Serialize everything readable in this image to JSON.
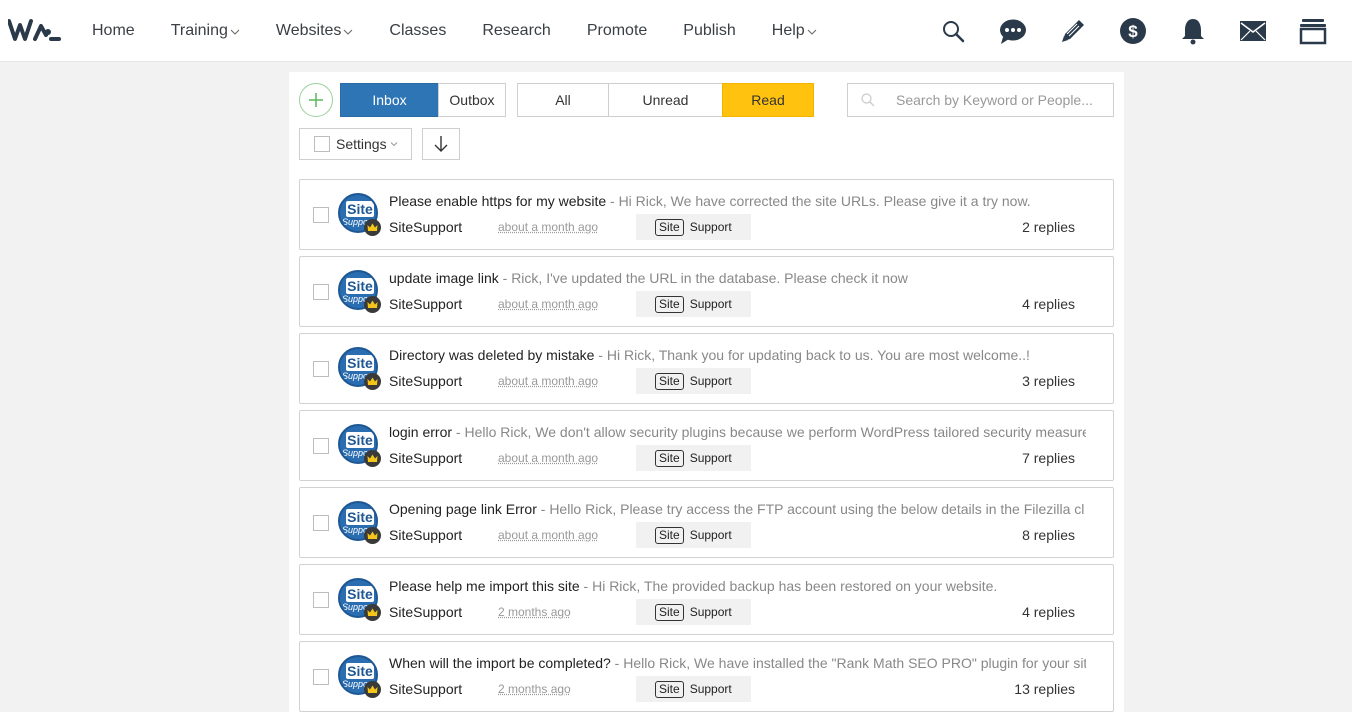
{
  "nav": {
    "items": [
      {
        "label": "Home",
        "dropdown": false
      },
      {
        "label": "Training",
        "dropdown": true
      },
      {
        "label": "Websites",
        "dropdown": true
      },
      {
        "label": "Classes",
        "dropdown": false
      },
      {
        "label": "Research",
        "dropdown": false
      },
      {
        "label": "Promote",
        "dropdown": false
      },
      {
        "label": "Publish",
        "dropdown": false
      },
      {
        "label": "Help",
        "dropdown": true
      }
    ],
    "icons": [
      "search-icon",
      "chat-icon",
      "pencil-icon",
      "dollar-icon",
      "bell-icon",
      "mail-icon",
      "tray-icon"
    ]
  },
  "toolbar": {
    "mailbox_tabs": [
      "Inbox",
      "Outbox"
    ],
    "active_mailbox": "Inbox",
    "filter_tabs": [
      "All",
      "Unread",
      "Read"
    ],
    "active_filter": "Read",
    "search_placeholder": "Search by Keyword or People...",
    "settings_label": "Settings"
  },
  "colors": {
    "accent_blue": "#2e75b6",
    "accent_yellow": "#ffc20e",
    "compose_green": "#5cb85c"
  },
  "messages": [
    {
      "subject": "Please enable https for my website",
      "preview": " - Hi Rick, We have corrected the site URLs. Please give it a try now.",
      "sender": "SiteSupport",
      "time": "about a month ago",
      "tag_site": "Site",
      "tag_label": "Support",
      "replies": "2 replies"
    },
    {
      "subject": "update image link",
      "preview": " - Rick, I've updated the URL in the database. Please check it now",
      "sender": "SiteSupport",
      "time": "about a month ago",
      "tag_site": "Site",
      "tag_label": "Support",
      "replies": "4 replies"
    },
    {
      "subject": "Directory was deleted by mistake",
      "preview": " - Hi Rick, Thank you for updating back to us. You are most welcome..!",
      "sender": "SiteSupport",
      "time": "about a month ago",
      "tag_site": "Site",
      "tag_label": "Support",
      "replies": "3 replies"
    },
    {
      "subject": "login error",
      "preview": " - Hello Rick, We don't allow security plugins because we perform WordPress tailored security measure",
      "sender": "SiteSupport",
      "time": "about a month ago",
      "tag_site": "Site",
      "tag_label": "Support",
      "replies": "7 replies"
    },
    {
      "subject": "Opening page link Error",
      "preview": " - Hello Rick, Please try access the FTP account using the below details in the Filezilla cl",
      "sender": "SiteSupport",
      "time": "about a month ago",
      "tag_site": "Site",
      "tag_label": "Support",
      "replies": "8 replies"
    },
    {
      "subject": "Please help me import this site",
      "preview": " - Hi Rick, The provided backup has been restored on your website.",
      "sender": "SiteSupport",
      "time": "2 months ago",
      "tag_site": "Site",
      "tag_label": "Support",
      "replies": "4 replies"
    },
    {
      "subject": "When will the import be completed?",
      "preview": " - Hello Rick, We have installed the \"Rank Math SEO PRO\" plugin for your sit",
      "sender": "SiteSupport",
      "time": "2 months ago",
      "tag_site": "Site",
      "tag_label": "Support",
      "replies": "13 replies"
    }
  ],
  "avatar": {
    "line1": "Site",
    "line2": "Support"
  }
}
